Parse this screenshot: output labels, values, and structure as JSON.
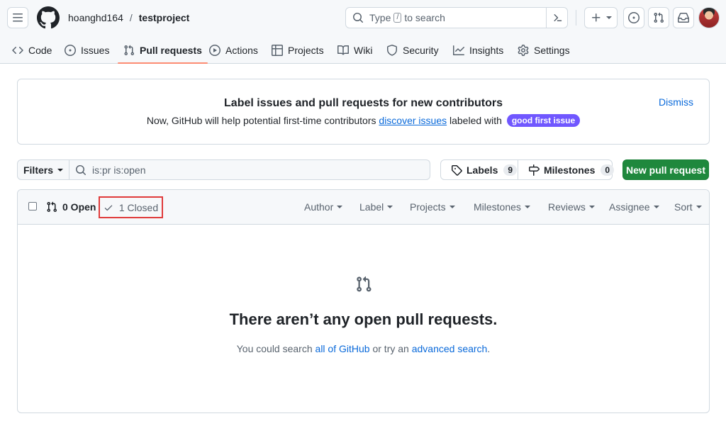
{
  "header": {
    "owner": "hoanghd164",
    "separator": "/",
    "repo": "testproject",
    "search": {
      "prefix": "Type",
      "key": "/",
      "suffix": "to search"
    }
  },
  "tabs": [
    {
      "label": "Code",
      "icon": "code-icon"
    },
    {
      "label": "Issues",
      "icon": "issue-opened-icon"
    },
    {
      "label": "Pull requests",
      "icon": "git-pull-request-icon",
      "active": true
    },
    {
      "label": "Actions",
      "icon": "play-icon"
    },
    {
      "label": "Projects",
      "icon": "table-icon"
    },
    {
      "label": "Wiki",
      "icon": "book-icon"
    },
    {
      "label": "Security",
      "icon": "shield-icon"
    },
    {
      "label": "Insights",
      "icon": "graph-icon"
    },
    {
      "label": "Settings",
      "icon": "gear-icon"
    }
  ],
  "banner": {
    "title": "Label issues and pull requests for new contributors",
    "desc_before": "Now, GitHub will help potential first-time contributors",
    "desc_link": "discover issues",
    "desc_after": "labeled with",
    "label": "good first issue",
    "dismiss": "Dismiss"
  },
  "filters": {
    "button": "Filters",
    "query": "is:pr is:open"
  },
  "labels_button": {
    "label": "Labels",
    "count": "9"
  },
  "milestones_button": {
    "label": "Milestones",
    "count": "0"
  },
  "new_pr": "New pull request",
  "list": {
    "open": "0 Open",
    "closed": "1 Closed",
    "filters": [
      "Author",
      "Label",
      "Projects",
      "Milestones",
      "Reviews",
      "Assignee",
      "Sort"
    ]
  },
  "blank": {
    "title": "There aren’t any open pull requests.",
    "sub_before": "You could search",
    "link1": "all of GitHub",
    "sub_mid": "or try an",
    "link2": "advanced search",
    "sub_after": "."
  },
  "colors": {
    "accent": "#0969da",
    "primary_button": "#1f883d",
    "active_tab_underline": "#fd8c73",
    "label_pill": "#7057ff",
    "highlight_box": "#e03b3b"
  }
}
